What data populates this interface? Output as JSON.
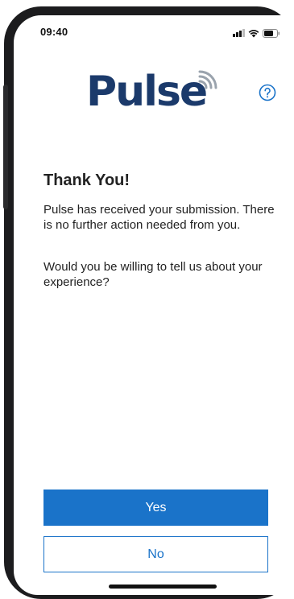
{
  "status_bar": {
    "time": "09:40",
    "icons": [
      "signal-icon",
      "wifi-icon",
      "battery-icon"
    ]
  },
  "header": {
    "logo_text": "Pulse",
    "help_icon": "question-circle-icon"
  },
  "content": {
    "title": "Thank You!",
    "message": "Pulse has received your submission. There is no further action needed from you.",
    "question": "Would you be willing to tell us about your experience?"
  },
  "actions": {
    "yes_label": "Yes",
    "no_label": "No"
  },
  "colors": {
    "brand_navy": "#1b3a6b",
    "accent_blue": "#1a73c9",
    "text": "#222222",
    "background": "#ffffff"
  }
}
